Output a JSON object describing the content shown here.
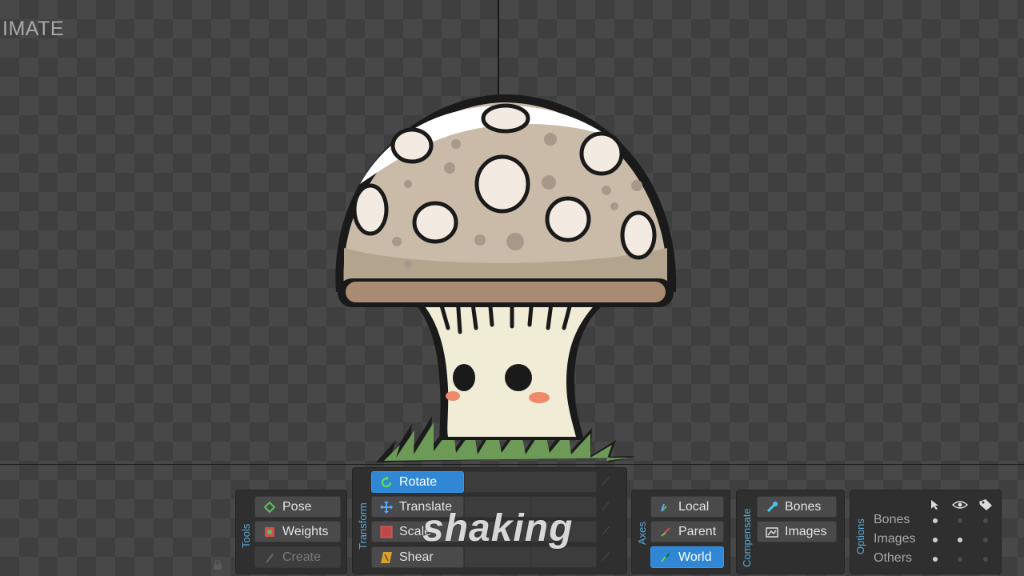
{
  "mode_label": "IMATE",
  "caption": "shaking",
  "tools": {
    "group_label": "Tools",
    "pose": "Pose",
    "weights": "Weights",
    "create": "Create"
  },
  "transform": {
    "group_label": "Transform",
    "rotate": "Rotate",
    "translate": "Translate",
    "scale": "Scale",
    "shear": "Shear"
  },
  "axes": {
    "group_label": "Axes",
    "local": "Local",
    "parent": "Parent",
    "world": "World"
  },
  "compensate": {
    "group_label": "Compensate",
    "bones": "Bones",
    "images": "Images"
  },
  "options": {
    "group_label": "Options",
    "rows": [
      "Bones",
      "Images",
      "Others"
    ]
  },
  "colors": {
    "active": "#2f87d6",
    "group_label": "#5aa9d6",
    "cap": "#c9bba8",
    "stem": "#f1ecd6",
    "grass": "#6e9a58"
  }
}
